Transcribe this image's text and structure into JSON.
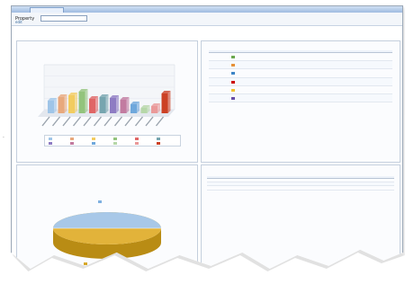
{
  "window": {
    "tab_label": ""
  },
  "toolbar": {
    "property_label": "Property",
    "property_value": "",
    "sub_link": "edit"
  },
  "panel_bar": {
    "title": "",
    "colors": [
      "#9fc5e8",
      "#e8a87c",
      "#f2cc60",
      "#93c47d",
      "#e06666",
      "#76a5af",
      "#8e7cc3",
      "#c27ba0",
      "#6fa8dc",
      "#b6d7a8",
      "#ea9999",
      "#cc4125"
    ]
  },
  "panel_table1": {
    "title": "",
    "headers": [
      "",
      "",
      "",
      "",
      "",
      "",
      ""
    ],
    "rows": [
      [
        "",
        "",
        "",
        "",
        "",
        "",
        ""
      ],
      [
        "",
        "",
        "",
        "",
        "",
        "",
        ""
      ],
      [
        "",
        "",
        "",
        "",
        "",
        "",
        ""
      ],
      [
        "",
        "",
        "",
        "",
        "",
        "",
        ""
      ],
      [
        "",
        "",
        "",
        "",
        "",
        "",
        ""
      ],
      [
        "",
        "",
        "",
        "",
        "",
        "",
        ""
      ]
    ],
    "row_colors": [
      "#6aa84f",
      "#e69138",
      "#3d85c6",
      "#cc0000",
      "#f1c232",
      "#674ea7"
    ]
  },
  "panel_pie": {
    "title": "",
    "subtitle": "",
    "legend_top": "",
    "legend_bottom": "",
    "colors": [
      "#9fc5e8",
      "#d9a520"
    ]
  },
  "panel_table2": {
    "title": "",
    "headers": [
      "",
      "",
      "",
      "",
      "",
      "",
      "",
      "",
      "",
      "",
      "",
      ""
    ],
    "rows": [
      [
        "",
        "",
        "",
        "",
        "",
        "",
        "",
        "",
        "",
        "",
        "",
        ""
      ],
      [
        "",
        "",
        "",
        "",
        "",
        "",
        "",
        "",
        "",
        "",
        "",
        ""
      ],
      [
        "",
        "",
        "",
        "",
        "",
        "",
        "",
        "",
        "",
        "",
        "",
        ""
      ]
    ]
  }
}
